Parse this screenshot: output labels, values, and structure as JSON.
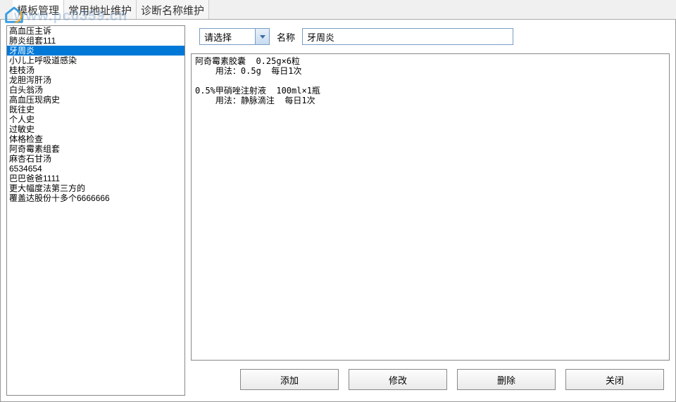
{
  "watermark": "www.pc0359.cn",
  "tabs": [
    {
      "label": "模板管理"
    },
    {
      "label": "常用地址维护"
    },
    {
      "label": "诊断名称维护"
    }
  ],
  "sidebar": {
    "items": [
      "高血压主诉",
      "肺炎组套111",
      "牙周炎",
      "小儿上呼吸道感染",
      "桂枝汤",
      "龙胆泻肝汤",
      "白头翁汤",
      "高血压现病史",
      "既往史",
      "个人史",
      "过敏史",
      "体格检查",
      "阿奇霉素组套",
      "麻杏石甘汤",
      "6534654",
      "巴巴爸爸1111",
      "更大幅度法第三方的",
      "覆盖达股份十多个6666666"
    ],
    "selectedIndex": 2
  },
  "form": {
    "select_value": "请选择",
    "name_label": "名称",
    "name_value": "牙周炎"
  },
  "content": "阿奇霉素胶囊  0.25g×6粒\n    用法：0.5g  每日1次\n\n0.5%甲硝唑注射液  100ml×1瓶\n    用法：静脉滴注  每日1次",
  "buttons": {
    "add": "添加",
    "modify": "修改",
    "delete": "删除",
    "close": "关闭"
  }
}
